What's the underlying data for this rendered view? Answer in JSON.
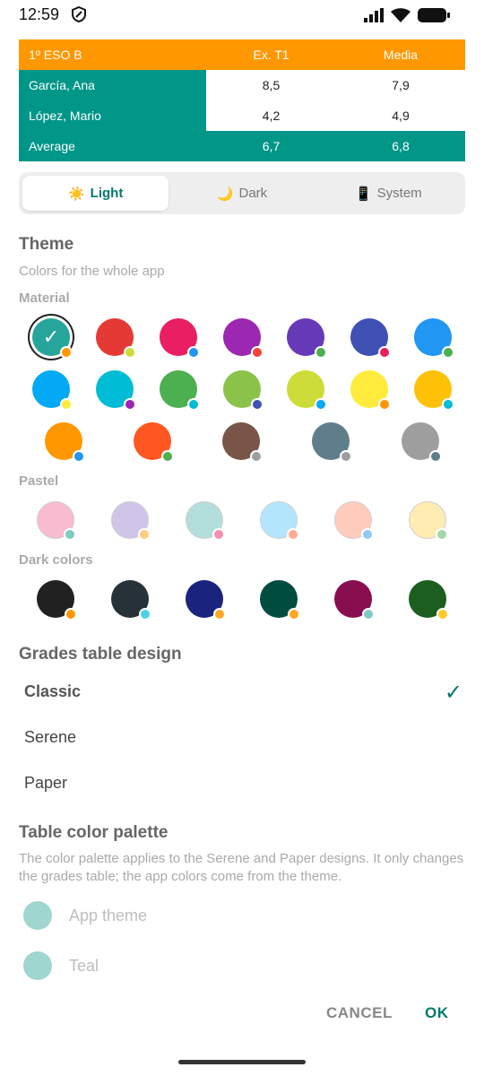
{
  "status": {
    "time": "12:59"
  },
  "grades_table": {
    "headers": [
      "1º ESO B",
      "Ex. T1",
      "Media"
    ],
    "rows": [
      [
        "García, Ana",
        "8,5",
        "7,9"
      ],
      [
        "López, Mario",
        "4,2",
        "4,9"
      ]
    ],
    "average": [
      "Average",
      "6,7",
      "6,8"
    ]
  },
  "mode_selector": {
    "items": [
      {
        "icon": "☀️",
        "label": "Light",
        "active": true
      },
      {
        "icon": "🌙",
        "label": "Dark",
        "active": false
      },
      {
        "icon": "📱",
        "label": "System",
        "active": false
      }
    ]
  },
  "theme": {
    "title": "Theme",
    "subtitle": "Colors for the whole app",
    "groups": {
      "material": {
        "label": "Material",
        "rows": [
          [
            [
              "#26a69a",
              "#ff9800"
            ],
            [
              "#e53935",
              "#cddc39"
            ],
            [
              "#e91e63",
              "#2196f3"
            ],
            [
              "#9c27b0",
              "#f44336"
            ],
            [
              "#673ab7",
              "#4caf50"
            ],
            [
              "#3f51b5",
              "#e91e63"
            ],
            [
              "#2196f3",
              "#4caf50"
            ]
          ],
          [
            [
              "#03a9f4",
              "#ffeb3b"
            ],
            [
              "#00bcd4",
              "#9c27b0"
            ],
            [
              "#4caf50",
              "#00bcd4"
            ],
            [
              "#8bc34a",
              "#3f51b5"
            ],
            [
              "#cddc39",
              "#03a9f4"
            ],
            [
              "#ffeb3b",
              "#ff9800"
            ],
            [
              "#ffc107",
              "#00bcd4"
            ]
          ],
          [
            [
              "#ff9800",
              "#2196f3"
            ],
            [
              "#ff5722",
              "#4caf50"
            ],
            [
              "#795548",
              "#9e9e9e"
            ],
            [
              "#607d8b",
              "#9e9e9e"
            ],
            [
              "#9e9e9e",
              "#607d8b"
            ]
          ]
        ]
      },
      "pastel": {
        "label": "Pastel",
        "colors": [
          [
            "#f8bbd0",
            "#80cbc4"
          ],
          [
            "#d1c4e9",
            "#ffcc80"
          ],
          [
            "#b2dfdb",
            "#f48fb1"
          ],
          [
            "#b3e5fc",
            "#ffab91"
          ],
          [
            "#ffccbc",
            "#90caf9"
          ],
          [
            "#ffecb3",
            "#a5d6a7"
          ]
        ]
      },
      "dark": {
        "label": "Dark colors",
        "colors": [
          [
            "#212121",
            "#ff9800"
          ],
          [
            "#263238",
            "#4dd0e1"
          ],
          [
            "#1a237e",
            "#ffa726"
          ],
          [
            "#004d40",
            "#ffa726"
          ],
          [
            "#880e4f",
            "#80cbc4"
          ],
          [
            "#1b5e20",
            "#ffca28"
          ]
        ]
      }
    },
    "selected_check": "✓"
  },
  "design": {
    "title": "Grades table design",
    "options": [
      "Classic",
      "Serene",
      "Paper"
    ],
    "selected_check": "✓"
  },
  "palette": {
    "title": "Table color palette",
    "description": "The color palette applies to the Serene and Paper designs. It only changes the grades table; the app colors come from the theme.",
    "options": [
      "App theme",
      "Teal"
    ]
  },
  "actions": {
    "cancel": "CANCEL",
    "ok": "OK"
  }
}
